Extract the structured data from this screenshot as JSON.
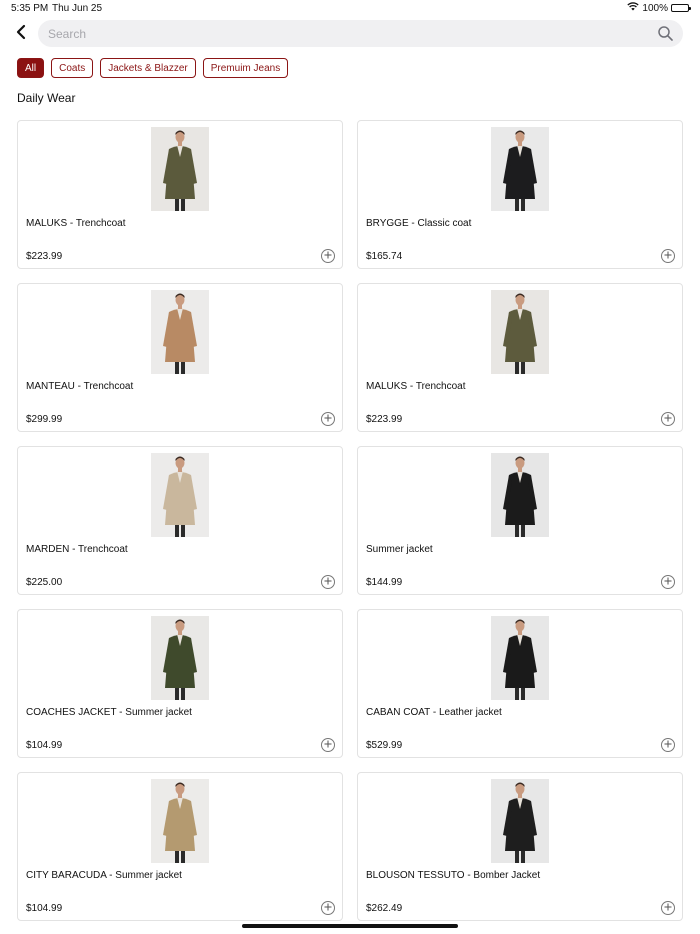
{
  "status": {
    "time": "5:35 PM",
    "date": "Thu Jun 25",
    "battery": "100%",
    "battery_level": 1.0
  },
  "search": {
    "placeholder": "Search"
  },
  "filters": [
    {
      "label": "All",
      "active": true
    },
    {
      "label": "Coats",
      "active": false
    },
    {
      "label": "Jackets & Blazzer",
      "active": false
    },
    {
      "label": "Premuim Jeans",
      "active": false
    }
  ],
  "section_title": "Daily Wear",
  "products": [
    {
      "name": "MALUKS - Trenchcoat",
      "price": "$223.99",
      "coat_color": "#5b5a3c",
      "bg": "#e8e6e3"
    },
    {
      "name": "BRYGGE - Classic coat",
      "price": "$165.74",
      "coat_color": "#1c1c1e",
      "bg": "#e9e9e9"
    },
    {
      "name": "MANTEAU - Trenchcoat",
      "price": "$299.99",
      "coat_color": "#b88a64",
      "bg": "#ecebea"
    },
    {
      "name": "MALUKS - Trenchcoat",
      "price": "$223.99",
      "coat_color": "#5d5b3d",
      "bg": "#e8e6e3"
    },
    {
      "name": "MARDEN - Trenchcoat",
      "price": "$225.00",
      "coat_color": "#c9b79d",
      "bg": "#ecebea"
    },
    {
      "name": "Summer jacket",
      "price": "$144.99",
      "coat_color": "#1b1b1b",
      "bg": "#e6e6e6"
    },
    {
      "name": "COACHES JACKET - Summer jacket",
      "price": "$104.99",
      "coat_color": "#3f4a2c",
      "bg": "#e9e8e6"
    },
    {
      "name": "CABAN COAT - Leather jacket",
      "price": "$529.99",
      "coat_color": "#1a1a1a",
      "bg": "#e7e7e7"
    },
    {
      "name": "CITY BARACUDA - Summer jacket",
      "price": "$104.99",
      "coat_color": "#b49a70",
      "bg": "#ecebe9"
    },
    {
      "name": "BLOUSON TESSUTO - Bomber Jacket",
      "price": "$262.49",
      "coat_color": "#1e1e1e",
      "bg": "#e7e7e7"
    }
  ],
  "icons": {
    "back": "chevron-left-icon",
    "search": "magnifier-icon",
    "add": "plus-circle-icon",
    "wifi": "wifi-icon",
    "battery": "battery-icon"
  },
  "colors": {
    "accent": "#8b1111",
    "chip_text": "#8b1515",
    "search_bg": "#f0f0f2"
  }
}
